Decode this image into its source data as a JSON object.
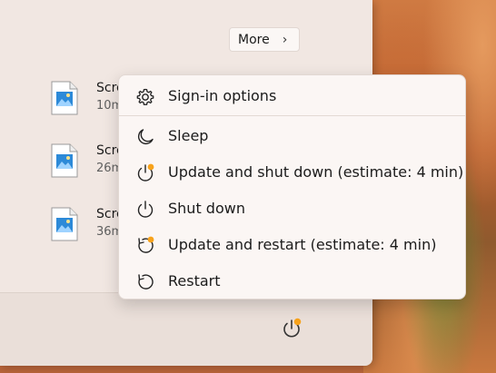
{
  "start_menu": {
    "more_label": "More",
    "recent_items": [
      {
        "name": "Scre",
        "time": "10m"
      },
      {
        "name": "Scre",
        "time": "26m"
      },
      {
        "name": "Scre",
        "time": "36m"
      }
    ]
  },
  "power_menu": {
    "items": [
      {
        "label": "Sign-in options",
        "icon": "gear-icon"
      },
      {
        "label": "Sleep",
        "icon": "moon-icon"
      },
      {
        "label": "Update and shut down (estimate: 4 min)",
        "icon": "power-update-icon"
      },
      {
        "label": "Shut down",
        "icon": "power-icon"
      },
      {
        "label": "Update and restart (estimate: 4 min)",
        "icon": "restart-update-icon"
      },
      {
        "label": "Restart",
        "icon": "restart-icon"
      }
    ]
  },
  "colors": {
    "accent_dot": "#f7a21b",
    "menu_bg": "#fbf6f4",
    "panel_bg": "#f1e7e2"
  }
}
